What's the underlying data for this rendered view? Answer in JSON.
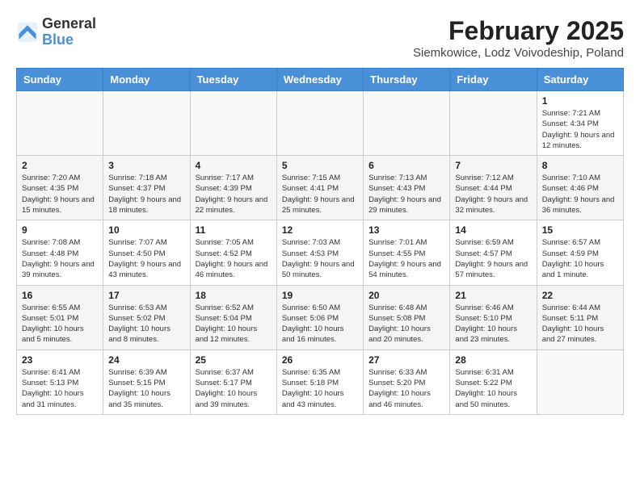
{
  "header": {
    "logo": {
      "line1": "General",
      "line2": "Blue"
    },
    "title": "February 2025",
    "subtitle": "Siemkowice, Lodz Voivodeship, Poland"
  },
  "calendar": {
    "headers": [
      "Sunday",
      "Monday",
      "Tuesday",
      "Wednesday",
      "Thursday",
      "Friday",
      "Saturday"
    ],
    "weeks": [
      {
        "days": [
          {
            "number": "",
            "info": ""
          },
          {
            "number": "",
            "info": ""
          },
          {
            "number": "",
            "info": ""
          },
          {
            "number": "",
            "info": ""
          },
          {
            "number": "",
            "info": ""
          },
          {
            "number": "",
            "info": ""
          },
          {
            "number": "1",
            "info": "Sunrise: 7:21 AM\nSunset: 4:34 PM\nDaylight: 9 hours and 12 minutes."
          }
        ]
      },
      {
        "days": [
          {
            "number": "2",
            "info": "Sunrise: 7:20 AM\nSunset: 4:35 PM\nDaylight: 9 hours and 15 minutes."
          },
          {
            "number": "3",
            "info": "Sunrise: 7:18 AM\nSunset: 4:37 PM\nDaylight: 9 hours and 18 minutes."
          },
          {
            "number": "4",
            "info": "Sunrise: 7:17 AM\nSunset: 4:39 PM\nDaylight: 9 hours and 22 minutes."
          },
          {
            "number": "5",
            "info": "Sunrise: 7:15 AM\nSunset: 4:41 PM\nDaylight: 9 hours and 25 minutes."
          },
          {
            "number": "6",
            "info": "Sunrise: 7:13 AM\nSunset: 4:43 PM\nDaylight: 9 hours and 29 minutes."
          },
          {
            "number": "7",
            "info": "Sunrise: 7:12 AM\nSunset: 4:44 PM\nDaylight: 9 hours and 32 minutes."
          },
          {
            "number": "8",
            "info": "Sunrise: 7:10 AM\nSunset: 4:46 PM\nDaylight: 9 hours and 36 minutes."
          }
        ]
      },
      {
        "days": [
          {
            "number": "9",
            "info": "Sunrise: 7:08 AM\nSunset: 4:48 PM\nDaylight: 9 hours and 39 minutes."
          },
          {
            "number": "10",
            "info": "Sunrise: 7:07 AM\nSunset: 4:50 PM\nDaylight: 9 hours and 43 minutes."
          },
          {
            "number": "11",
            "info": "Sunrise: 7:05 AM\nSunset: 4:52 PM\nDaylight: 9 hours and 46 minutes."
          },
          {
            "number": "12",
            "info": "Sunrise: 7:03 AM\nSunset: 4:53 PM\nDaylight: 9 hours and 50 minutes."
          },
          {
            "number": "13",
            "info": "Sunrise: 7:01 AM\nSunset: 4:55 PM\nDaylight: 9 hours and 54 minutes."
          },
          {
            "number": "14",
            "info": "Sunrise: 6:59 AM\nSunset: 4:57 PM\nDaylight: 9 hours and 57 minutes."
          },
          {
            "number": "15",
            "info": "Sunrise: 6:57 AM\nSunset: 4:59 PM\nDaylight: 10 hours and 1 minute."
          }
        ]
      },
      {
        "days": [
          {
            "number": "16",
            "info": "Sunrise: 6:55 AM\nSunset: 5:01 PM\nDaylight: 10 hours and 5 minutes."
          },
          {
            "number": "17",
            "info": "Sunrise: 6:53 AM\nSunset: 5:02 PM\nDaylight: 10 hours and 8 minutes."
          },
          {
            "number": "18",
            "info": "Sunrise: 6:52 AM\nSunset: 5:04 PM\nDaylight: 10 hours and 12 minutes."
          },
          {
            "number": "19",
            "info": "Sunrise: 6:50 AM\nSunset: 5:06 PM\nDaylight: 10 hours and 16 minutes."
          },
          {
            "number": "20",
            "info": "Sunrise: 6:48 AM\nSunset: 5:08 PM\nDaylight: 10 hours and 20 minutes."
          },
          {
            "number": "21",
            "info": "Sunrise: 6:46 AM\nSunset: 5:10 PM\nDaylight: 10 hours and 23 minutes."
          },
          {
            "number": "22",
            "info": "Sunrise: 6:44 AM\nSunset: 5:11 PM\nDaylight: 10 hours and 27 minutes."
          }
        ]
      },
      {
        "days": [
          {
            "number": "23",
            "info": "Sunrise: 6:41 AM\nSunset: 5:13 PM\nDaylight: 10 hours and 31 minutes."
          },
          {
            "number": "24",
            "info": "Sunrise: 6:39 AM\nSunset: 5:15 PM\nDaylight: 10 hours and 35 minutes."
          },
          {
            "number": "25",
            "info": "Sunrise: 6:37 AM\nSunset: 5:17 PM\nDaylight: 10 hours and 39 minutes."
          },
          {
            "number": "26",
            "info": "Sunrise: 6:35 AM\nSunset: 5:18 PM\nDaylight: 10 hours and 43 minutes."
          },
          {
            "number": "27",
            "info": "Sunrise: 6:33 AM\nSunset: 5:20 PM\nDaylight: 10 hours and 46 minutes."
          },
          {
            "number": "28",
            "info": "Sunrise: 6:31 AM\nSunset: 5:22 PM\nDaylight: 10 hours and 50 minutes."
          },
          {
            "number": "",
            "info": ""
          }
        ]
      }
    ]
  }
}
